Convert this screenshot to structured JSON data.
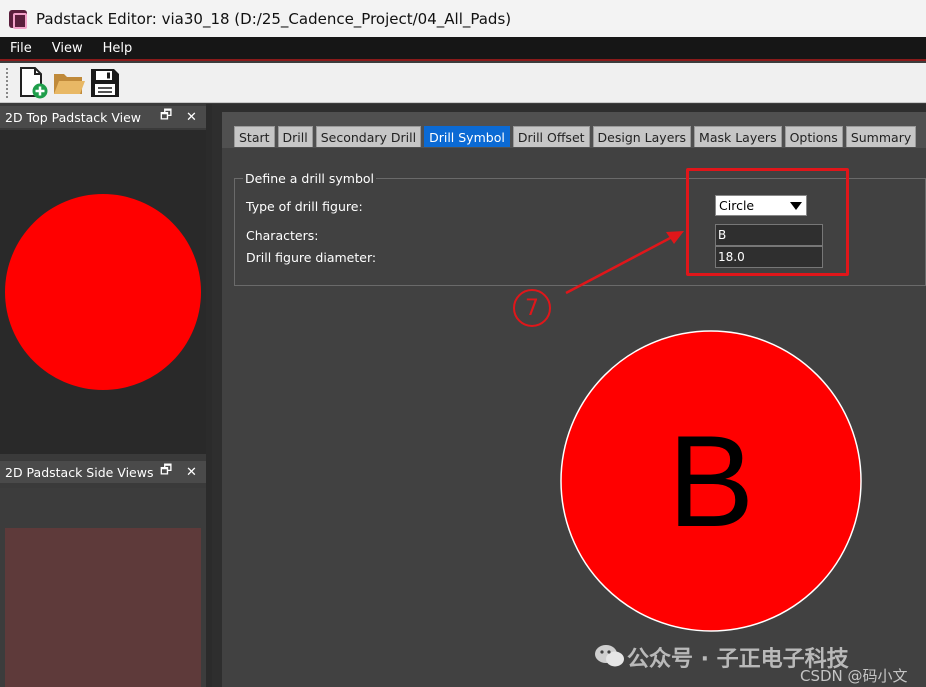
{
  "window": {
    "title": "Padstack Editor: via30_18  (D:/25_Cadence_Project/04_All_Pads)"
  },
  "menu": [
    "File",
    "View",
    "Help"
  ],
  "toolbar": {
    "buttons": [
      "new-icon",
      "open-folder-icon",
      "save-icon"
    ]
  },
  "panels": {
    "top_view_title": "2D Top Padstack View",
    "side_view_title": "2D Padstack Side Views",
    "float_glyph": "🗗",
    "close_glyph": "✕"
  },
  "tabs": [
    {
      "label": "Start",
      "active": false
    },
    {
      "label": "Drill",
      "active": false
    },
    {
      "label": "Secondary Drill",
      "active": false
    },
    {
      "label": "Drill Symbol",
      "active": true
    },
    {
      "label": "Drill Offset",
      "active": false
    },
    {
      "label": "Design Layers",
      "active": false
    },
    {
      "label": "Mask Layers",
      "active": false
    },
    {
      "label": "Options",
      "active": false
    },
    {
      "label": "Summary",
      "active": false
    }
  ],
  "drill_symbol": {
    "group_title": "Define a drill symbol",
    "type_label": "Type of drill figure:",
    "type_value": "Circle",
    "characters_label": "Characters:",
    "characters_value": "B",
    "diameter_label": "Drill figure diameter:",
    "diameter_value": "18.0"
  },
  "preview": {
    "character": "B",
    "fill_color": "#ff0000"
  },
  "annotation": {
    "step_number": "⑦",
    "color": "#e0161a"
  },
  "watermark": {
    "line1": "公众号 · 子正电子科技",
    "line2": "CSDN @码小文"
  }
}
